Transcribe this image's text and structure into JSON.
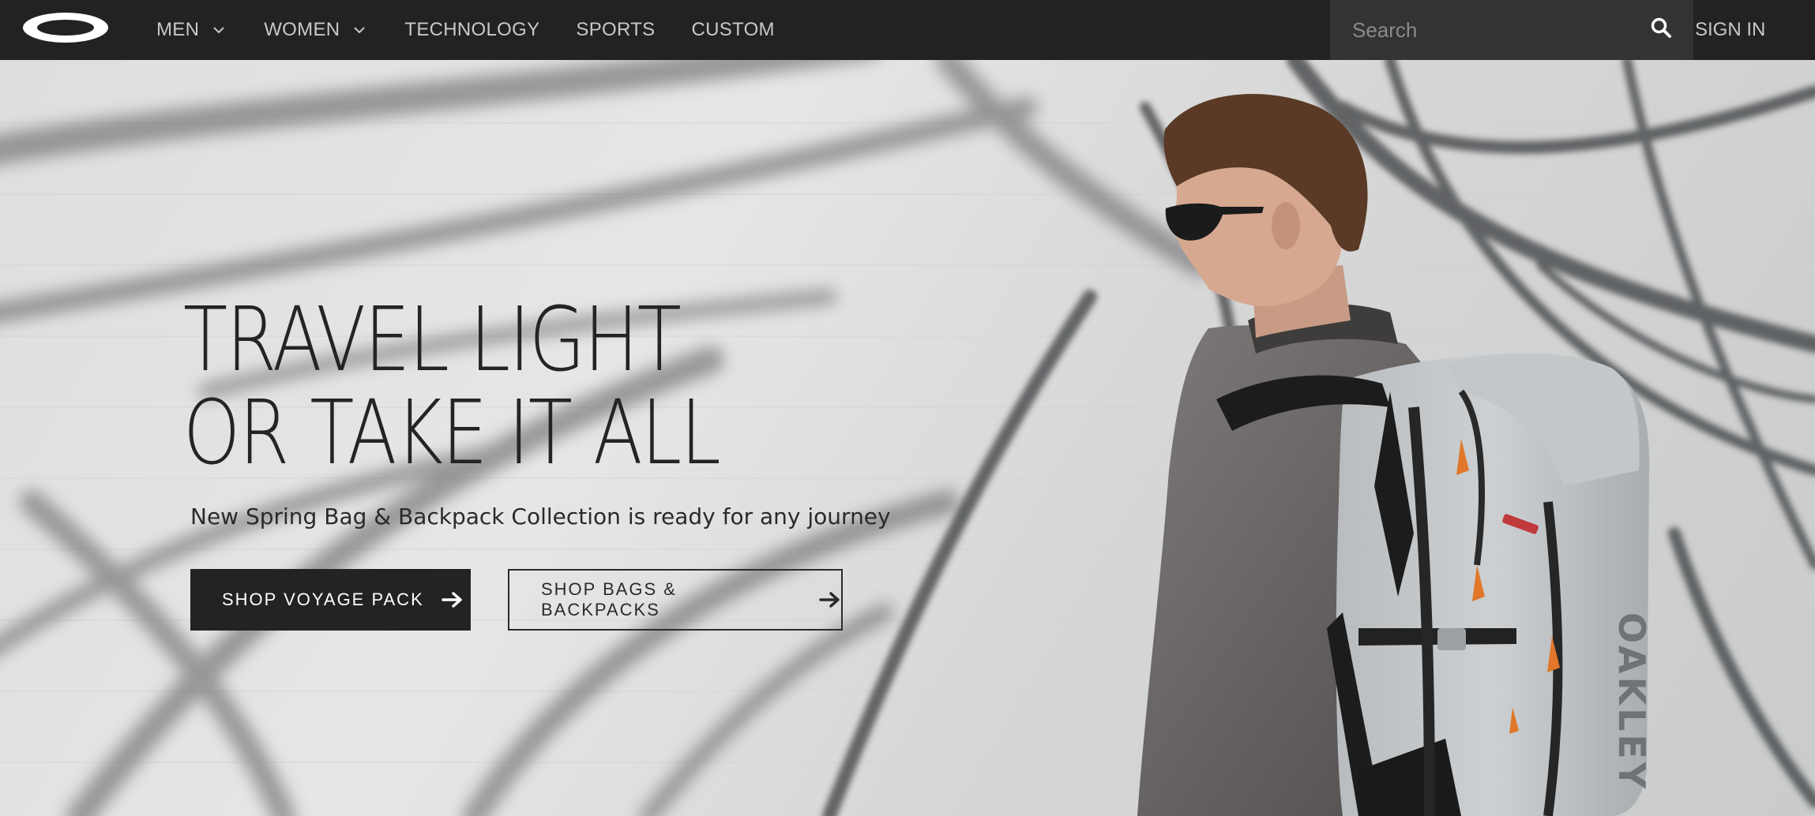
{
  "brand": {
    "logo": "oakley-ellipse-logo"
  },
  "nav": {
    "items": [
      {
        "label": "MEN",
        "has_dropdown": true
      },
      {
        "label": "WOMEN",
        "has_dropdown": true
      },
      {
        "label": "TECHNOLOGY",
        "has_dropdown": false
      },
      {
        "label": "SPORTS",
        "has_dropdown": false
      },
      {
        "label": "CUSTOM",
        "has_dropdown": false
      }
    ],
    "search": {
      "placeholder": "Search",
      "icon": "search-icon"
    },
    "sign_in": "SIGN IN"
  },
  "hero": {
    "headline_line1": "TRAVEL LIGHT",
    "headline_line2": "OR TAKE IT ALL",
    "subhead": "New Spring Bag & Backpack Collection is ready for any journey",
    "primary_cta": "SHOP VOYAGE PACK",
    "secondary_cta": "SHOP BAGS & BACKPACKS",
    "image": "man-with-grey-backpack-photo"
  },
  "colors": {
    "nav_bg": "#222222",
    "search_bg": "#333333",
    "text_dark": "#242424",
    "accent_orange": "#e0772a"
  }
}
